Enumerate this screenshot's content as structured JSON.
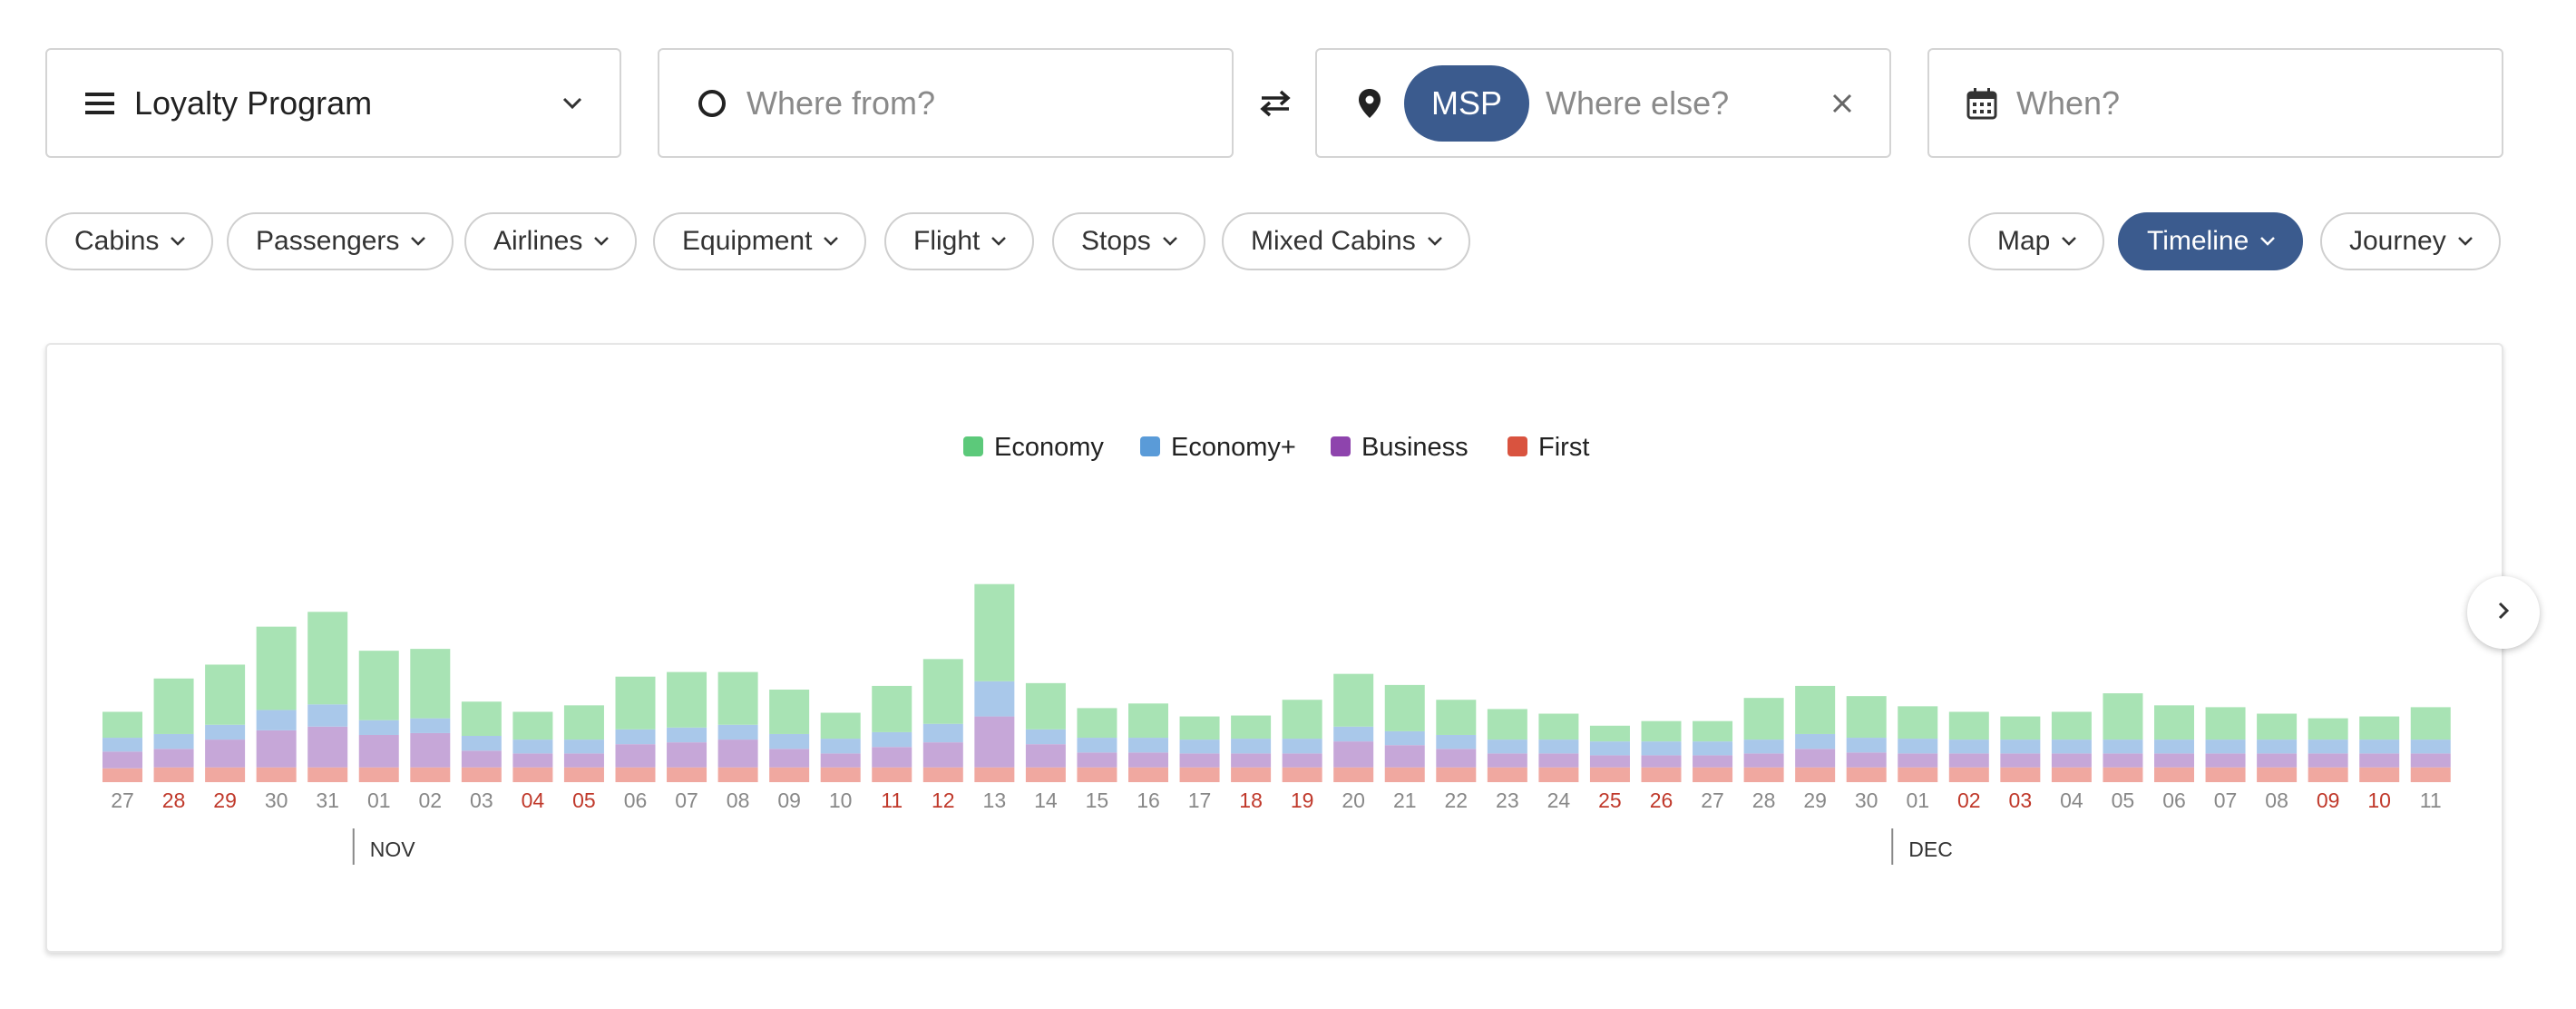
{
  "search": {
    "program_label": "Loyalty Program",
    "from_placeholder": "Where from?",
    "to_chip": "MSP",
    "to_placeholder": "Where else?",
    "when_placeholder": "When?"
  },
  "filters": {
    "items": [
      "Cabins",
      "Passengers",
      "Airlines",
      "Equipment",
      "Flight",
      "Stops",
      "Mixed Cabins"
    ]
  },
  "views": {
    "items": [
      "Map",
      "Timeline",
      "Journey"
    ],
    "active": "Timeline"
  },
  "colors": {
    "accent": "#3b5b8e",
    "economy": "#a8e3b4",
    "economy_plus": "#a9c8ea",
    "business": "#c6a7d8",
    "first": "#f0a8a0",
    "weekend_label": "#c0392b",
    "weekday_label": "#888888"
  },
  "icons": {
    "program": "menu-icon",
    "from": "circle-origin-icon",
    "swap": "swap-arrows-icon",
    "to": "map-pin-icon",
    "clear": "close-icon",
    "when": "calendar-icon",
    "next": "chevron-right-icon"
  },
  "chart_data": {
    "type": "bar",
    "stacked": true,
    "legend": [
      "Economy",
      "Economy+",
      "Business",
      "First"
    ],
    "legend_colors": [
      "#5cc97a",
      "#5a9bd8",
      "#8e44ad",
      "#d9533f"
    ],
    "categories": [
      "27",
      "28",
      "29",
      "30",
      "31",
      "01",
      "02",
      "03",
      "04",
      "05",
      "06",
      "07",
      "08",
      "09",
      "10",
      "11",
      "12",
      "13",
      "14",
      "15",
      "16",
      "17",
      "18",
      "19",
      "20",
      "21",
      "22",
      "23",
      "24",
      "25",
      "26",
      "27",
      "28",
      "29",
      "30",
      "01",
      "02",
      "03",
      "04",
      "05",
      "06",
      "07",
      "08",
      "09",
      "10",
      "11"
    ],
    "weekend_flags": [
      false,
      true,
      true,
      false,
      false,
      false,
      false,
      false,
      true,
      true,
      false,
      false,
      false,
      false,
      false,
      true,
      true,
      false,
      false,
      false,
      false,
      false,
      true,
      true,
      false,
      false,
      false,
      false,
      false,
      true,
      true,
      false,
      false,
      false,
      false,
      false,
      true,
      true,
      false,
      false,
      false,
      false,
      false,
      true,
      true,
      false
    ],
    "month_markers": [
      {
        "label": "NOV",
        "index": 5
      },
      {
        "label": "DEC",
        "index": 35
      }
    ],
    "series": [
      {
        "name": "First",
        "values": [
          15,
          16,
          16,
          16,
          16,
          16,
          16,
          16,
          16,
          16,
          16,
          16,
          16,
          16,
          16,
          16,
          16,
          16,
          16,
          16,
          16,
          16,
          16,
          16,
          16,
          16,
          16,
          16,
          16,
          16,
          16,
          16,
          16,
          16,
          16,
          16,
          16,
          16,
          16,
          16,
          16,
          16,
          16,
          16,
          16,
          16
        ]
      },
      {
        "name": "Business",
        "values": [
          18,
          20,
          30,
          40,
          44,
          35,
          37,
          18,
          15,
          15,
          25,
          27,
          30,
          20,
          15,
          22,
          27,
          55,
          25,
          16,
          16,
          15,
          15,
          15,
          28,
          24,
          20,
          15,
          15,
          13,
          13,
          13,
          15,
          20,
          16,
          15,
          15,
          15,
          15,
          15,
          15,
          15,
          15,
          15,
          15,
          15
        ]
      },
      {
        "name": "Economy+",
        "values": [
          15,
          16,
          16,
          22,
          24,
          16,
          16,
          16,
          15,
          15,
          16,
          16,
          16,
          16,
          16,
          16,
          20,
          38,
          16,
          16,
          16,
          15,
          16,
          16,
          16,
          15,
          15,
          15,
          15,
          15,
          15,
          15,
          15,
          16,
          16,
          16,
          15,
          15,
          15,
          15,
          15,
          15,
          15,
          15,
          15,
          15
        ]
      },
      {
        "name": "Economy",
        "values": [
          28,
          60,
          65,
          90,
          100,
          75,
          75,
          37,
          30,
          37,
          57,
          60,
          57,
          48,
          28,
          50,
          70,
          105,
          50,
          32,
          37,
          25,
          25,
          42,
          57,
          50,
          38,
          33,
          28,
          17,
          22,
          22,
          45,
          52,
          45,
          35,
          30,
          25,
          30,
          50,
          37,
          35,
          28,
          23,
          25,
          35
        ]
      }
    ]
  }
}
